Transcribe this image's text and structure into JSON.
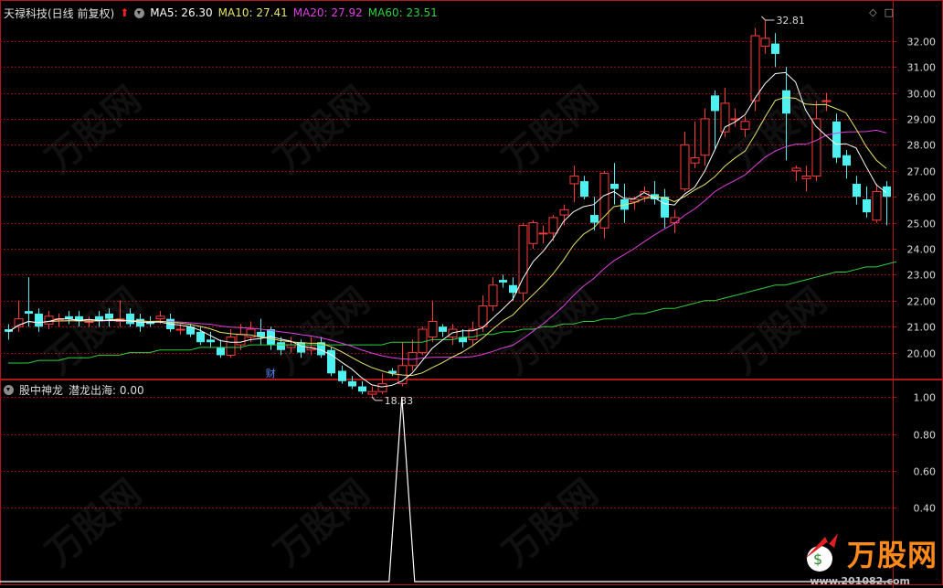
{
  "header": {
    "stock_title": "天禄科技(日线 前复权)",
    "ma5_label": "MA5: 26.30",
    "ma10_label": "MA10: 27.41",
    "ma20_label": "MA20: 27.92",
    "ma60_label": "MA60: 23.51"
  },
  "colors": {
    "ma5": "#ffffff",
    "ma10": "#e8e46a",
    "ma20": "#e040e0",
    "ma60": "#30d040",
    "up": "#ff3b3b",
    "down": "#4ef0f0",
    "grid": "#8a1010",
    "axis": "#b01818"
  },
  "indicator": {
    "legend_name": "股中神龙",
    "line_label": "潜龙出海: 0.00"
  },
  "watermark": {
    "brand": "万股网",
    "url": "www.201082.com",
    "ghost": "万股网"
  },
  "chart_data": [
    {
      "type": "candlestick",
      "title": "天禄科技(日线 前复权)",
      "ylim": [
        19,
        32.8
      ],
      "yticks": [
        "32.00",
        "31.00",
        "30.00",
        "29.00",
        "28.00",
        "27.00",
        "26.00",
        "25.00",
        "24.00",
        "23.00",
        "22.00",
        "21.00",
        "20.00"
      ],
      "annotations": {
        "high": "32.81",
        "low": "18.33",
        "event_marker": "财"
      },
      "candles": [
        [
          20.9,
          20.8,
          21.1,
          20.5
        ],
        [
          21.0,
          21.3,
          22.0,
          20.8
        ],
        [
          21.6,
          21.5,
          22.9,
          21.0
        ],
        [
          21.5,
          21.0,
          21.7,
          20.8
        ],
        [
          21.1,
          21.4,
          21.6,
          20.9
        ],
        [
          21.3,
          21.3,
          21.5,
          21.0
        ],
        [
          21.4,
          21.3,
          21.6,
          21.1
        ],
        [
          21.4,
          21.2,
          21.6,
          21.0
        ],
        [
          21.2,
          21.2,
          21.4,
          21.0
        ],
        [
          21.4,
          21.2,
          21.6,
          21.0
        ],
        [
          21.5,
          21.3,
          21.7,
          21.0
        ],
        [
          21.2,
          21.3,
          22.0,
          21.0
        ],
        [
          21.5,
          21.1,
          21.7,
          21.0
        ],
        [
          21.3,
          21.0,
          21.5,
          20.8
        ],
        [
          21.2,
          21.1,
          21.4,
          21.0
        ],
        [
          21.3,
          21.4,
          21.6,
          21.1
        ],
        [
          21.3,
          20.9,
          21.5,
          20.8
        ],
        [
          20.9,
          20.9,
          21.1,
          20.7
        ],
        [
          21.0,
          20.7,
          21.1,
          20.6
        ],
        [
          20.8,
          20.4,
          21.0,
          20.3
        ],
        [
          20.5,
          20.4,
          20.8,
          20.2
        ],
        [
          20.2,
          19.9,
          20.5,
          19.8
        ],
        [
          19.9,
          20.6,
          20.9,
          19.8
        ],
        [
          20.3,
          20.7,
          21.1,
          20.1
        ],
        [
          20.6,
          20.9,
          21.2,
          20.4
        ],
        [
          20.8,
          20.6,
          21.3,
          20.3
        ],
        [
          20.9,
          20.3,
          21.0,
          20.1
        ],
        [
          20.4,
          20.1,
          20.6,
          19.9
        ],
        [
          20.2,
          20.3,
          20.6,
          20.0
        ],
        [
          20.4,
          20.0,
          20.5,
          19.8
        ],
        [
          20.1,
          20.2,
          20.6,
          19.9
        ],
        [
          20.4,
          19.9,
          20.6,
          19.8
        ],
        [
          20.1,
          19.2,
          20.2,
          19.1
        ],
        [
          19.3,
          18.9,
          19.5,
          18.8
        ],
        [
          18.9,
          18.7,
          19.1,
          18.6
        ],
        [
          18.7,
          18.5,
          18.9,
          18.4
        ],
        [
          18.4,
          18.5,
          18.7,
          18.3
        ],
        [
          18.5,
          18.8,
          19.2,
          18.4
        ],
        [
          19.3,
          19.2,
          19.4,
          19.1
        ],
        [
          18.8,
          19.5,
          20.4,
          18.7
        ],
        [
          19.5,
          20.0,
          20.5,
          19.3
        ],
        [
          20.0,
          20.9,
          21.0,
          19.9
        ],
        [
          20.6,
          21.2,
          22.0,
          20.4
        ],
        [
          21.0,
          20.8,
          21.1,
          20.6
        ],
        [
          20.6,
          20.9,
          21.1,
          20.3
        ],
        [
          20.6,
          20.4,
          20.9,
          20.2
        ],
        [
          20.5,
          20.9,
          21.2,
          20.3
        ],
        [
          21.0,
          21.8,
          22.2,
          20.8
        ],
        [
          21.8,
          22.6,
          22.9,
          21.6
        ],
        [
          22.8,
          22.7,
          23.0,
          22.5
        ],
        [
          22.6,
          22.3,
          22.9,
          22.0
        ],
        [
          22.3,
          24.9,
          25.0,
          22.0
        ],
        [
          24.2,
          25.0,
          25.1,
          24.0
        ],
        [
          24.6,
          24.6,
          24.9,
          24.2
        ],
        [
          24.6,
          25.2,
          25.3,
          24.3
        ],
        [
          25.3,
          25.5,
          25.7,
          24.9
        ],
        [
          26.5,
          26.8,
          27.2,
          25.8
        ],
        [
          26.6,
          26.0,
          26.8,
          25.9
        ],
        [
          25.3,
          25.0,
          26.0,
          24.7
        ],
        [
          24.8,
          26.9,
          27.0,
          24.4
        ],
        [
          26.5,
          26.3,
          27.3,
          25.7
        ],
        [
          25.9,
          25.5,
          26.5,
          25.0
        ],
        [
          25.8,
          25.9,
          26.0,
          25.5
        ],
        [
          26.0,
          26.2,
          26.4,
          25.8
        ],
        [
          26.1,
          25.9,
          26.6,
          25.7
        ],
        [
          26.0,
          25.2,
          26.3,
          24.8
        ],
        [
          25.0,
          25.2,
          25.5,
          24.6
        ],
        [
          26.3,
          28.0,
          28.5,
          26.2
        ],
        [
          27.3,
          27.5,
          28.9,
          27.1
        ],
        [
          27.6,
          29.0,
          29.4,
          27.2
        ],
        [
          29.9,
          29.3,
          30.1,
          27.8
        ],
        [
          28.5,
          29.6,
          30.2,
          28.3
        ],
        [
          29.0,
          29.0,
          29.4,
          28.7
        ],
        [
          28.6,
          28.9,
          29.1,
          28.3
        ],
        [
          29.7,
          32.2,
          32.5,
          29.3
        ],
        [
          31.8,
          32.1,
          32.8,
          31.5
        ],
        [
          31.9,
          31.5,
          32.3,
          31.0
        ],
        [
          30.1,
          29.2,
          31.0,
          27.4
        ],
        [
          27.0,
          27.1,
          27.2,
          26.6
        ],
        [
          26.7,
          26.8,
          27.2,
          26.2
        ],
        [
          26.8,
          29.0,
          29.7,
          26.6
        ],
        [
          29.7,
          29.7,
          30.0,
          29.3
        ],
        [
          28.9,
          27.5,
          29.2,
          27.3
        ],
        [
          27.6,
          27.2,
          27.8,
          26.7
        ],
        [
          26.5,
          26.0,
          26.8,
          25.7
        ],
        [
          25.9,
          25.4,
          26.4,
          25.2
        ],
        [
          25.1,
          26.2,
          26.5,
          25.0
        ],
        [
          26.4,
          26.0,
          26.6,
          24.9
        ]
      ],
      "ma60": [
        19.6,
        19.6,
        19.6,
        19.7,
        19.7,
        19.7,
        19.8,
        19.8,
        19.8,
        19.9,
        19.9,
        19.9,
        20.0,
        20.0,
        20.0,
        20.1,
        20.1,
        20.1,
        20.1,
        20.2,
        20.2,
        20.2,
        20.2,
        20.2,
        20.3,
        20.3,
        20.3,
        20.3,
        20.3,
        20.3,
        20.3,
        20.3,
        20.3,
        20.3,
        20.3,
        20.3,
        20.3,
        20.3,
        20.4,
        20.4,
        20.4,
        20.4,
        20.5,
        20.5,
        20.5,
        20.6,
        20.6,
        20.7,
        20.7,
        20.8,
        20.8,
        20.9,
        20.9,
        21.0,
        21.0,
        21.1,
        21.1,
        21.2,
        21.2,
        21.3,
        21.3,
        21.4,
        21.5,
        21.5,
        21.6,
        21.7,
        21.7,
        21.8,
        21.9,
        22.0,
        22.0,
        22.1,
        22.2,
        22.3,
        22.4,
        22.5,
        22.6,
        22.6,
        22.7,
        22.8,
        22.9,
        23.0,
        23.1,
        23.1,
        23.2,
        23.3,
        23.3,
        23.4,
        23.5
      ]
    },
    {
      "type": "line",
      "name": "潜龙出海",
      "ylim": [
        0,
        1.08
      ],
      "yticks": [
        "1.00",
        "0.80",
        "0.60",
        "0.40"
      ],
      "spike_index": 39,
      "spike_value": 1.0,
      "last_value": 0.0
    }
  ]
}
